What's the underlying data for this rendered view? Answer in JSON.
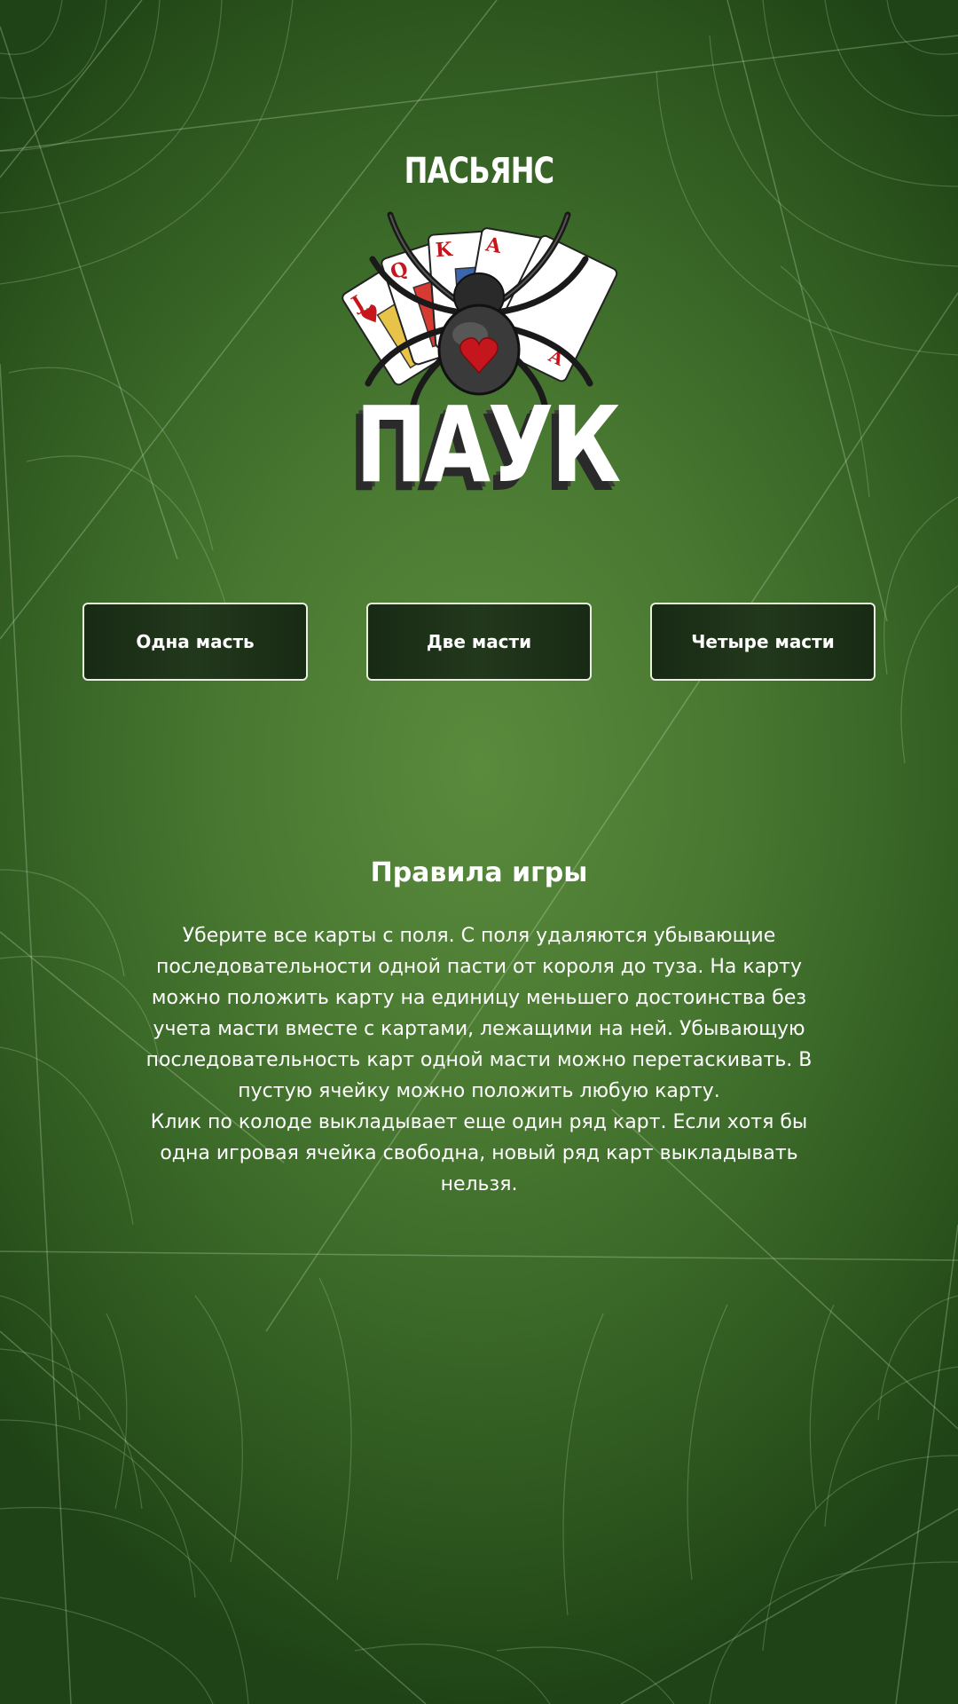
{
  "logo": {
    "top_text": "ПАСЬЯНС",
    "main_text": "ПАУК"
  },
  "modes": [
    {
      "label": "Одна масть"
    },
    {
      "label": "Две масти"
    },
    {
      "label": "Четыре масти"
    }
  ],
  "rules": {
    "title": "Правила игры",
    "paragraph1": "Уберите все карты с поля. С поля удаляются убывающие последовательности одной пасти от короля до туза. На карту можно положить карту на единицу меньшего достоинства без учета масти вместе с картами, лежащими на ней. Убывающую последовательность карт одной масти можно перетаскивать. В пустую ячейку можно положить любую карту.",
    "paragraph2": "Клик по колоде выкладывает еще один ряд карт. Если хотя бы одна игровая ячейка свободна, новый ряд карт выкладывать нельзя."
  },
  "colors": {
    "background_center": "#5a8a3c",
    "background_edge": "#1f4316",
    "button_fill": "#1e3218",
    "button_border": "#e8f0e0",
    "heart_red": "#c4161c"
  }
}
